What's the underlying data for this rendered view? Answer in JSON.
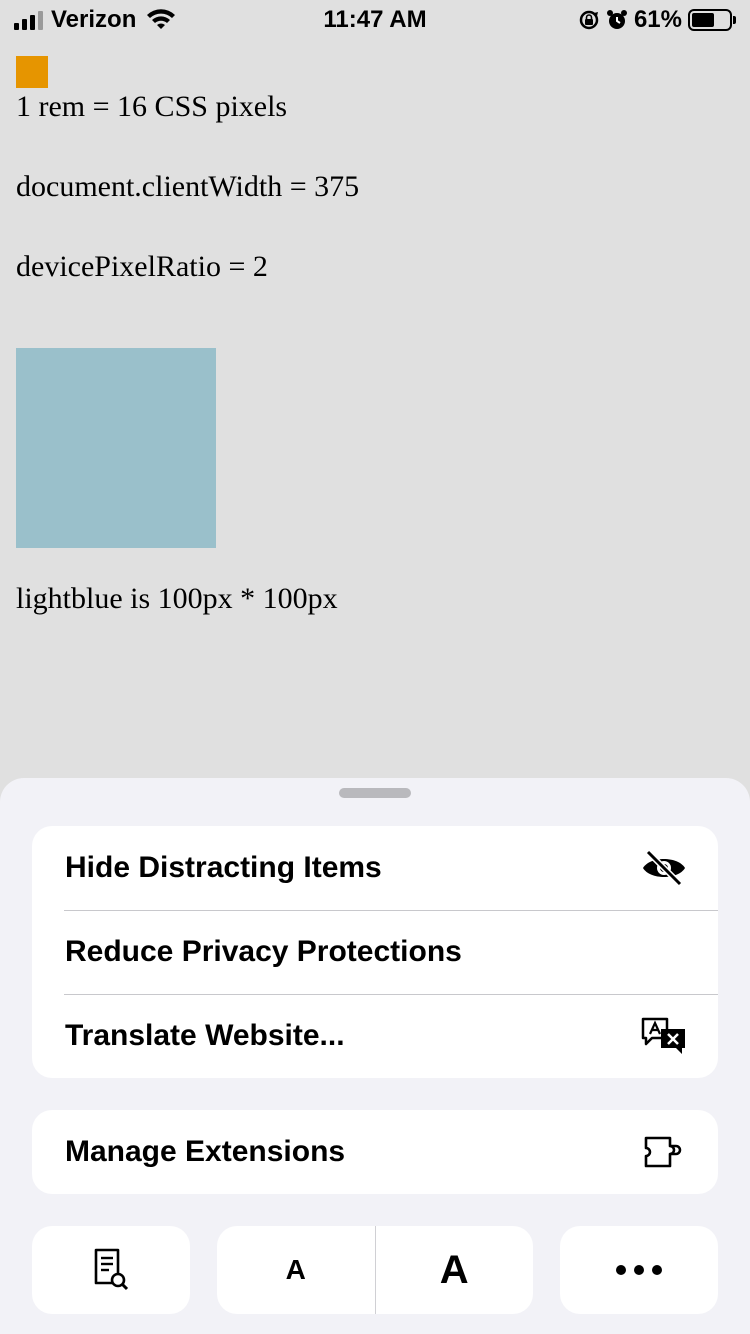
{
  "status_bar": {
    "carrier": "Verizon",
    "time": "11:47 AM",
    "battery_percent": "61%",
    "battery_level": 0.61,
    "icons": [
      "signal-icon",
      "wifi-icon",
      "orientation-lock-icon",
      "alarm-icon",
      "battery-icon"
    ]
  },
  "page": {
    "line_rem": "1 rem = 16 CSS pixels",
    "line_client_width": "document.clientWidth = 375",
    "line_pixel_ratio": "devicePixelRatio = 2",
    "line_lightblue": "lightblue is 100px * 100px",
    "colors": {
      "orange_square": "#e69500",
      "lightblue_box": "#9ac0cb",
      "background": "#e0e0e0"
    }
  },
  "sheet": {
    "menu_items": [
      {
        "label": "Hide Distracting Items",
        "icon": "eye-slash-icon"
      },
      {
        "label": "Reduce Privacy Protections",
        "icon": ""
      },
      {
        "label": "Translate Website...",
        "icon": "translate-icon"
      }
    ],
    "manage_extensions": {
      "label": "Manage Extensions",
      "icon": "puzzle-piece-icon"
    },
    "toolbar": {
      "reader_icon": "reader-search-icon",
      "font_smaller": "A",
      "font_larger": "A",
      "more_icon": "more-icon"
    }
  }
}
